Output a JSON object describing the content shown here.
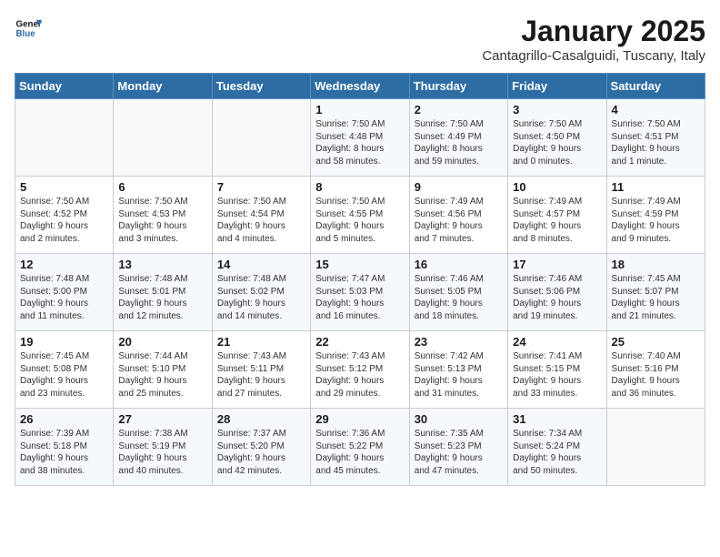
{
  "header": {
    "logo_line1": "General",
    "logo_line2": "Blue",
    "month": "January 2025",
    "location": "Cantagrillo-Casalguidi, Tuscany, Italy"
  },
  "weekdays": [
    "Sunday",
    "Monday",
    "Tuesday",
    "Wednesday",
    "Thursday",
    "Friday",
    "Saturday"
  ],
  "weeks": [
    [
      {
        "day": "",
        "info": ""
      },
      {
        "day": "",
        "info": ""
      },
      {
        "day": "",
        "info": ""
      },
      {
        "day": "1",
        "info": "Sunrise: 7:50 AM\nSunset: 4:48 PM\nDaylight: 8 hours\nand 58 minutes."
      },
      {
        "day": "2",
        "info": "Sunrise: 7:50 AM\nSunset: 4:49 PM\nDaylight: 8 hours\nand 59 minutes."
      },
      {
        "day": "3",
        "info": "Sunrise: 7:50 AM\nSunset: 4:50 PM\nDaylight: 9 hours\nand 0 minutes."
      },
      {
        "day": "4",
        "info": "Sunrise: 7:50 AM\nSunset: 4:51 PM\nDaylight: 9 hours\nand 1 minute."
      }
    ],
    [
      {
        "day": "5",
        "info": "Sunrise: 7:50 AM\nSunset: 4:52 PM\nDaylight: 9 hours\nand 2 minutes."
      },
      {
        "day": "6",
        "info": "Sunrise: 7:50 AM\nSunset: 4:53 PM\nDaylight: 9 hours\nand 3 minutes."
      },
      {
        "day": "7",
        "info": "Sunrise: 7:50 AM\nSunset: 4:54 PM\nDaylight: 9 hours\nand 4 minutes."
      },
      {
        "day": "8",
        "info": "Sunrise: 7:50 AM\nSunset: 4:55 PM\nDaylight: 9 hours\nand 5 minutes."
      },
      {
        "day": "9",
        "info": "Sunrise: 7:49 AM\nSunset: 4:56 PM\nDaylight: 9 hours\nand 7 minutes."
      },
      {
        "day": "10",
        "info": "Sunrise: 7:49 AM\nSunset: 4:57 PM\nDaylight: 9 hours\nand 8 minutes."
      },
      {
        "day": "11",
        "info": "Sunrise: 7:49 AM\nSunset: 4:59 PM\nDaylight: 9 hours\nand 9 minutes."
      }
    ],
    [
      {
        "day": "12",
        "info": "Sunrise: 7:48 AM\nSunset: 5:00 PM\nDaylight: 9 hours\nand 11 minutes."
      },
      {
        "day": "13",
        "info": "Sunrise: 7:48 AM\nSunset: 5:01 PM\nDaylight: 9 hours\nand 12 minutes."
      },
      {
        "day": "14",
        "info": "Sunrise: 7:48 AM\nSunset: 5:02 PM\nDaylight: 9 hours\nand 14 minutes."
      },
      {
        "day": "15",
        "info": "Sunrise: 7:47 AM\nSunset: 5:03 PM\nDaylight: 9 hours\nand 16 minutes."
      },
      {
        "day": "16",
        "info": "Sunrise: 7:46 AM\nSunset: 5:05 PM\nDaylight: 9 hours\nand 18 minutes."
      },
      {
        "day": "17",
        "info": "Sunrise: 7:46 AM\nSunset: 5:06 PM\nDaylight: 9 hours\nand 19 minutes."
      },
      {
        "day": "18",
        "info": "Sunrise: 7:45 AM\nSunset: 5:07 PM\nDaylight: 9 hours\nand 21 minutes."
      }
    ],
    [
      {
        "day": "19",
        "info": "Sunrise: 7:45 AM\nSunset: 5:08 PM\nDaylight: 9 hours\nand 23 minutes."
      },
      {
        "day": "20",
        "info": "Sunrise: 7:44 AM\nSunset: 5:10 PM\nDaylight: 9 hours\nand 25 minutes."
      },
      {
        "day": "21",
        "info": "Sunrise: 7:43 AM\nSunset: 5:11 PM\nDaylight: 9 hours\nand 27 minutes."
      },
      {
        "day": "22",
        "info": "Sunrise: 7:43 AM\nSunset: 5:12 PM\nDaylight: 9 hours\nand 29 minutes."
      },
      {
        "day": "23",
        "info": "Sunrise: 7:42 AM\nSunset: 5:13 PM\nDaylight: 9 hours\nand 31 minutes."
      },
      {
        "day": "24",
        "info": "Sunrise: 7:41 AM\nSunset: 5:15 PM\nDaylight: 9 hours\nand 33 minutes."
      },
      {
        "day": "25",
        "info": "Sunrise: 7:40 AM\nSunset: 5:16 PM\nDaylight: 9 hours\nand 36 minutes."
      }
    ],
    [
      {
        "day": "26",
        "info": "Sunrise: 7:39 AM\nSunset: 5:18 PM\nDaylight: 9 hours\nand 38 minutes."
      },
      {
        "day": "27",
        "info": "Sunrise: 7:38 AM\nSunset: 5:19 PM\nDaylight: 9 hours\nand 40 minutes."
      },
      {
        "day": "28",
        "info": "Sunrise: 7:37 AM\nSunset: 5:20 PM\nDaylight: 9 hours\nand 42 minutes."
      },
      {
        "day": "29",
        "info": "Sunrise: 7:36 AM\nSunset: 5:22 PM\nDaylight: 9 hours\nand 45 minutes."
      },
      {
        "day": "30",
        "info": "Sunrise: 7:35 AM\nSunset: 5:23 PM\nDaylight: 9 hours\nand 47 minutes."
      },
      {
        "day": "31",
        "info": "Sunrise: 7:34 AM\nSunset: 5:24 PM\nDaylight: 9 hours\nand 50 minutes."
      },
      {
        "day": "",
        "info": ""
      }
    ]
  ]
}
